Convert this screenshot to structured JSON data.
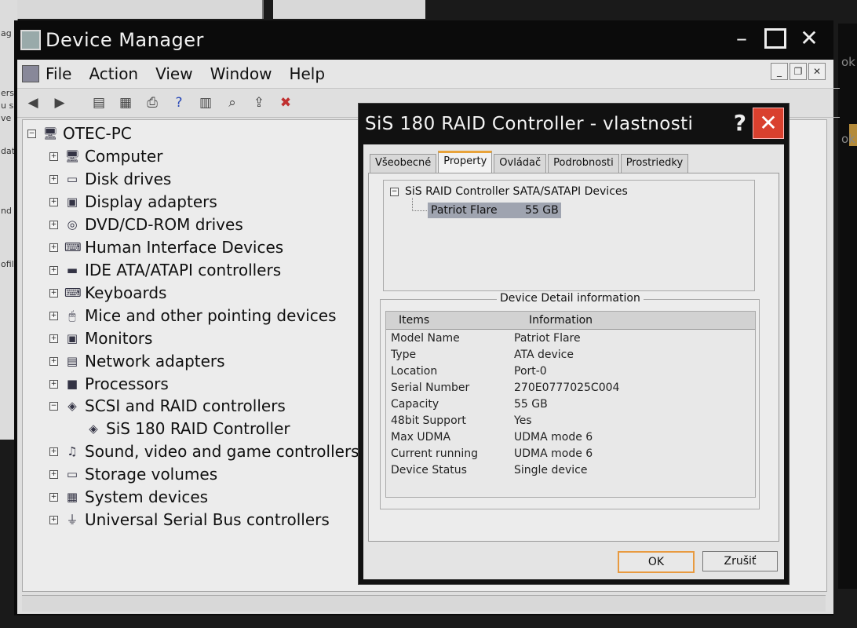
{
  "window": {
    "title": "Device Manager",
    "controls": [
      "–",
      "☐",
      "✕"
    ]
  },
  "menubar": {
    "items": [
      "File",
      "Action",
      "View",
      "Window",
      "Help"
    ]
  },
  "toolbar": {
    "icons": [
      "back-icon",
      "forward-icon",
      "show-hide-tree-icon",
      "properties-icon",
      "print-icon",
      "help-icon",
      "view-icon",
      "scan-hardware-icon",
      "update-driver-icon",
      "uninstall-icon"
    ]
  },
  "tree": {
    "root": "OTEC-PC",
    "items": [
      {
        "label": "Computer"
      },
      {
        "label": "Disk drives"
      },
      {
        "label": "Display adapters"
      },
      {
        "label": "DVD/CD-ROM drives"
      },
      {
        "label": "Human Interface Devices"
      },
      {
        "label": "IDE ATA/ATAPI controllers"
      },
      {
        "label": "Keyboards"
      },
      {
        "label": "Mice and other pointing devices"
      },
      {
        "label": "Monitors"
      },
      {
        "label": "Network adapters"
      },
      {
        "label": "Processors"
      },
      {
        "label": "SCSI and RAID controllers"
      },
      {
        "label": "SiS 180 RAID Controller"
      },
      {
        "label": "Sound, video and game controllers"
      },
      {
        "label": "Storage volumes"
      },
      {
        "label": "System devices"
      },
      {
        "label": "Universal Serial Bus controllers"
      }
    ]
  },
  "dialog": {
    "title": "SiS 180 RAID Controller - vlastnosti",
    "help": "?",
    "close": "✕",
    "tabs": [
      "Všeobecné",
      "Property",
      "Ovládač",
      "Podrobnosti",
      "Prostriedky"
    ],
    "active_tab": "Property",
    "device_tree": {
      "root": "SiS RAID Controller SATA/SATAPI Devices",
      "child_name": "Patriot Flare",
      "child_size": "55 GB"
    },
    "detail": {
      "legend": "Device Detail information",
      "headers": [
        "Items",
        "Information"
      ],
      "rows": [
        [
          "Model Name",
          "Patriot Flare"
        ],
        [
          "Type",
          "ATA device"
        ],
        [
          "Location",
          "Port-0"
        ],
        [
          "Serial Number",
          "270E0777025C004"
        ],
        [
          "Capacity",
          "55 GB"
        ],
        [
          "48bit Support",
          "Yes"
        ],
        [
          "Max UDMA",
          "UDMA mode 6"
        ],
        [
          "Current running",
          "UDMA mode 6"
        ],
        [
          "Device Status",
          "Single device"
        ]
      ]
    },
    "buttons": {
      "ok": "OK",
      "cancel": "Zrušiť"
    }
  }
}
